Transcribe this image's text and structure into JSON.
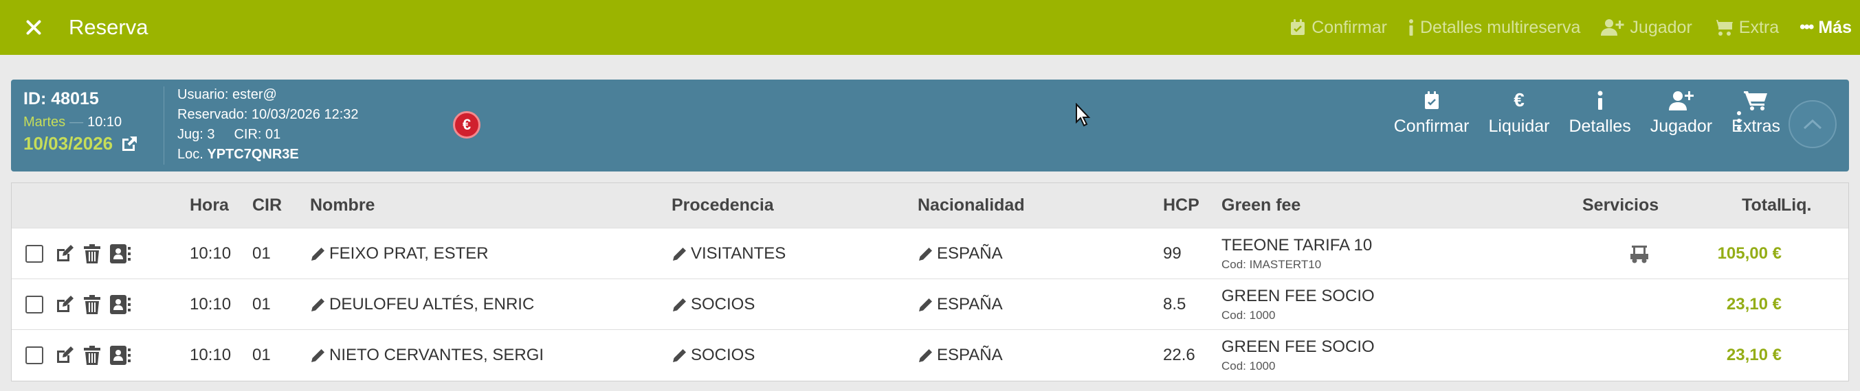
{
  "header": {
    "title": "Reserva",
    "actions": {
      "confirmar": "Confirmar",
      "detalles_multireserva": "Detalles multireserva",
      "jugador": "Jugador",
      "extra": "Extra",
      "mas": "Más"
    }
  },
  "reservation": {
    "id_label": "ID: 48015",
    "day_of_week": "Martes",
    "time": "10:10",
    "date": "10/03/2026",
    "usuario": "Usuario: ester@",
    "reservado": "Reservado: 10/03/2026 12:32",
    "jug": "Jug: 3",
    "cir": "CIR: 01",
    "loc_label": "Loc.",
    "loc_code": "YPTC7QNR3E",
    "badge": "€"
  },
  "panel_actions": {
    "confirmar": "Confirmar",
    "liquidar": "Liquidar",
    "detalles": "Detalles",
    "jugador": "Jugador",
    "extras": "Extras"
  },
  "table": {
    "headers": {
      "hora": "Hora",
      "cir": "CIR",
      "nombre": "Nombre",
      "procedencia": "Procedencia",
      "nacionalidad": "Nacionalidad",
      "hcp": "HCP",
      "green_fee": "Green fee",
      "servicios": "Servicios",
      "total": "Total",
      "liq": "Liq."
    },
    "rows": [
      {
        "hora": "10:10",
        "cir": "01",
        "nombre": "FEIXO PRAT, ESTER",
        "procedencia": "VISITANTES",
        "nacionalidad": "ESPAÑA",
        "hcp": "99",
        "green_fee": "TEEONE TARIFA 10",
        "green_fee_cod": "Cod: IMASTERT10",
        "total": "105,00 €"
      },
      {
        "hora": "10:10",
        "cir": "01",
        "nombre": "DEULOFEU ALTÉS, ENRIC",
        "procedencia": "SOCIOS",
        "nacionalidad": "ESPAÑA",
        "hcp": "8.5",
        "green_fee": "GREEN FEE SOCIO",
        "green_fee_cod": "Cod: 1000",
        "total": "23,10 €"
      },
      {
        "hora": "10:10",
        "cir": "01",
        "nombre": "NIETO CERVANTES, SERGI",
        "procedencia": "SOCIOS",
        "nacionalidad": "ESPAÑA",
        "hcp": "22.6",
        "green_fee": "GREEN FEE SOCIO",
        "green_fee_cod": "Cod: 1000",
        "total": "23,10 €"
      }
    ]
  },
  "colors": {
    "topbar": "#9bb400",
    "panel": "#4b8099",
    "accent_date": "#c6dd59",
    "total": "#94ad16",
    "badge": "#d0202e"
  }
}
